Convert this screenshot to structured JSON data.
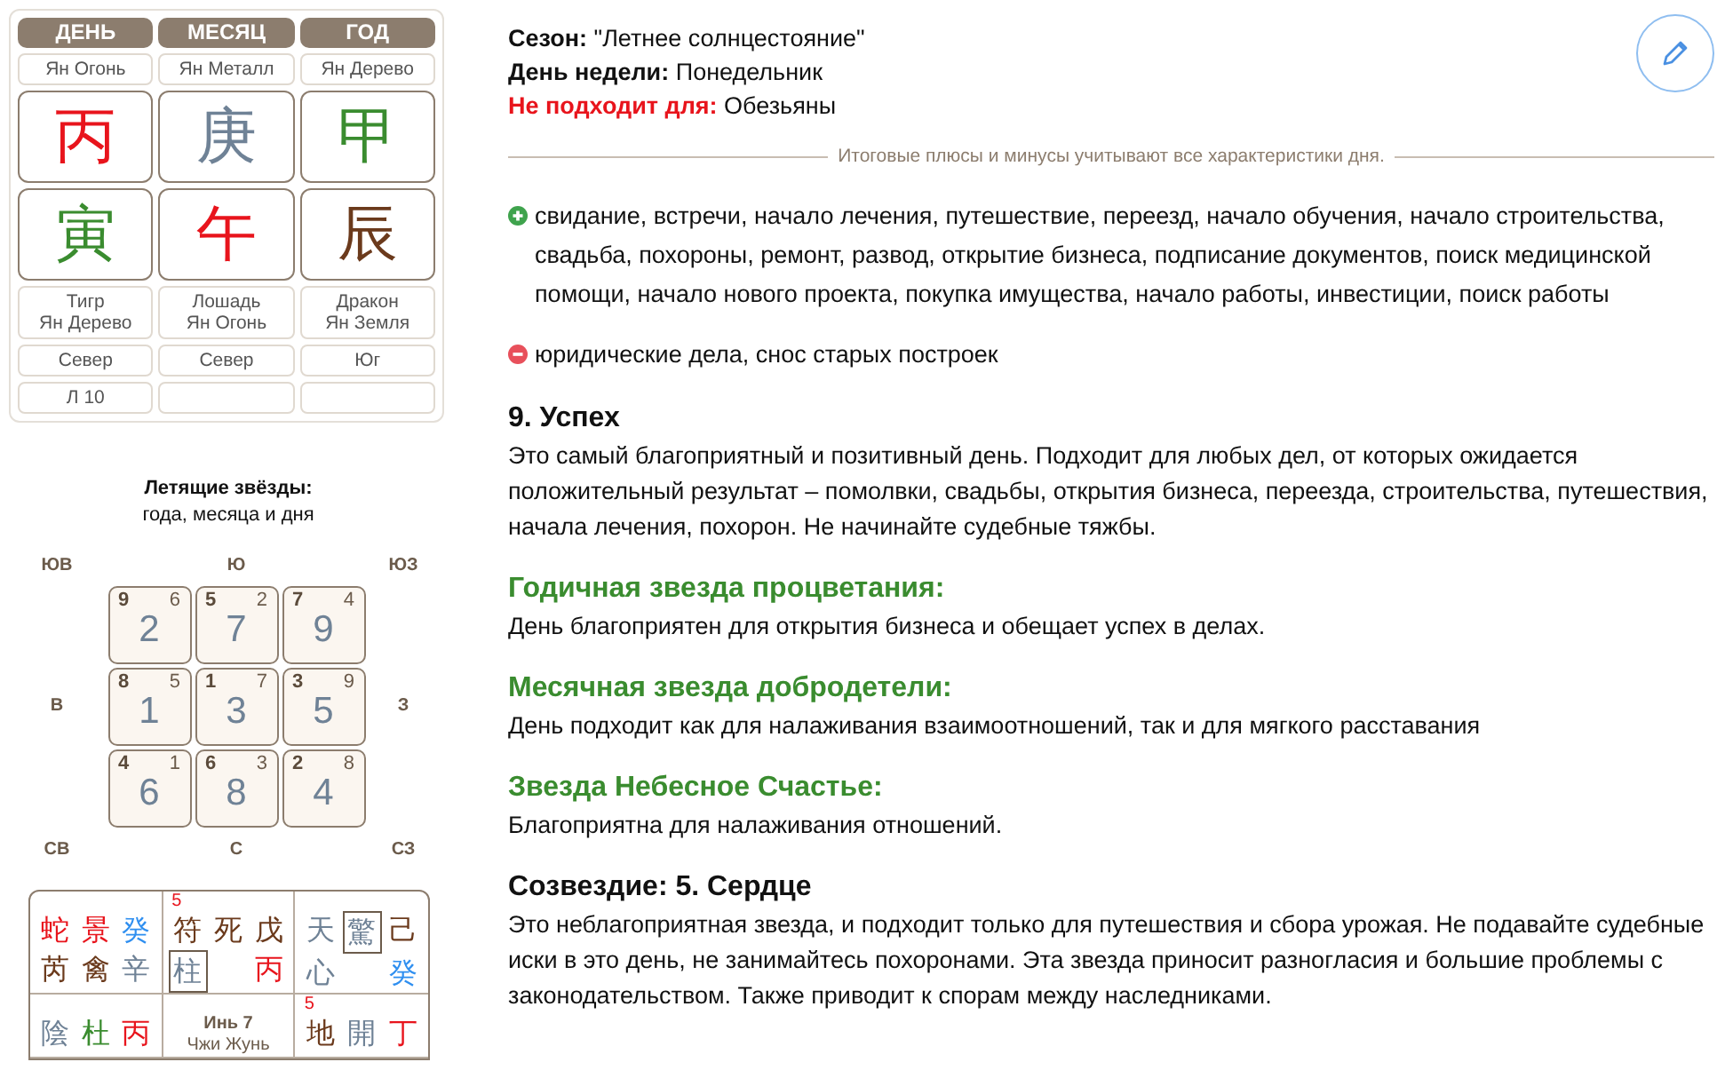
{
  "pillars": [
    {
      "heading": "ДЕНЬ",
      "element": "Ян Огонь",
      "stem": {
        "char": "丙",
        "color": "#e8141c"
      },
      "branch": {
        "char": "寅",
        "color": "#3a8c2f"
      },
      "animal": "Тигр",
      "animal_element": "Ян Дерево",
      "direction": "Север",
      "extra": "Л 10"
    },
    {
      "heading": "МЕСЯЦ",
      "element": "Ян Металл",
      "stem": {
        "char": "庚",
        "color": "#6f8296"
      },
      "branch": {
        "char": "午",
        "color": "#e8141c"
      },
      "animal": "Лошадь",
      "animal_element": "Ян Огонь",
      "direction": "Север"
    },
    {
      "heading": "ГОД",
      "element": "Ян Дерево",
      "stem": {
        "char": "甲",
        "color": "#3a8c2f"
      },
      "branch": {
        "char": "辰",
        "color": "#6b3a1c"
      },
      "animal": "Дракон",
      "animal_element": "Ян Земля",
      "direction": "Юг"
    }
  ],
  "flying_stars": {
    "title": "Летящие звёзды:",
    "subtitle": "года, месяца и дня",
    "directions_top": [
      "ЮВ",
      "Ю",
      "ЮЗ"
    ],
    "directions_middle": [
      "В",
      "З"
    ],
    "directions_bottom": [
      "СВ",
      "С",
      "СЗ"
    ],
    "cells": [
      {
        "year": "9",
        "month": "6",
        "day": "2"
      },
      {
        "year": "5",
        "month": "2",
        "day": "7"
      },
      {
        "year": "7",
        "month": "4",
        "day": "9"
      },
      {
        "year": "8",
        "month": "5",
        "day": "1"
      },
      {
        "year": "1",
        "month": "7",
        "day": "3"
      },
      {
        "year": "3",
        "month": "9",
        "day": "5"
      },
      {
        "year": "4",
        "month": "1",
        "day": "6"
      },
      {
        "year": "6",
        "month": "3",
        "day": "8"
      },
      {
        "year": "2",
        "month": "8",
        "day": "4"
      }
    ]
  },
  "qimen": [
    {
      "rows": [
        [
          {
            "char": "蛇",
            "color": "#e8141c",
            "boxed": false
          },
          {
            "char": "景",
            "color": "#e8141c",
            "boxed": false
          },
          {
            "char": "癸",
            "color": "#2f8ff0",
            "boxed": false
          }
        ],
        [
          {
            "char": "芮",
            "color": "#6b3a1c",
            "boxed": false
          },
          {
            "char": "禽",
            "color": "#6b3a1c",
            "boxed": false
          },
          {
            "char": "辛",
            "color": "#6f8296",
            "boxed": false
          }
        ]
      ]
    },
    {
      "number": "5",
      "rows": [
        [
          {
            "char": "符",
            "color": "#6b3a1c",
            "boxed": false
          },
          {
            "char": "死",
            "color": "#6b3a1c",
            "boxed": false
          },
          {
            "char": "戊",
            "color": "#6b3a1c",
            "boxed": false
          }
        ],
        [
          {
            "char": "柱",
            "color": "#6f8296",
            "boxed": true
          },
          null,
          {
            "char": "丙",
            "color": "#e8141c",
            "boxed": false
          }
        ]
      ]
    },
    {
      "rows": [
        [
          {
            "char": "天",
            "color": "#6f8296",
            "boxed": false
          },
          {
            "char": "驚",
            "color": "#6f8296",
            "boxed": true
          },
          {
            "char": "己",
            "color": "#6b3a1c",
            "boxed": false
          }
        ],
        [
          {
            "char": "心",
            "color": "#6f8296",
            "boxed": false
          },
          null,
          {
            "char": "癸",
            "color": "#2f8ff0",
            "boxed": false
          }
        ]
      ]
    },
    {
      "rows": [
        [
          {
            "char": "陰",
            "color": "#6f8296",
            "boxed": false
          },
          {
            "char": "杜",
            "color": "#3a8c2f",
            "boxed": false
          },
          {
            "char": "丙",
            "color": "#e8141c",
            "boxed": false
          }
        ]
      ]
    },
    {
      "center": [
        "Инь 7",
        "Чжи Жунь"
      ]
    },
    {
      "number": "5",
      "rows": [
        [
          {
            "char": "地",
            "color": "#6b3a1c",
            "boxed": false
          },
          {
            "char": "開",
            "color": "#6f8296",
            "boxed": false
          },
          {
            "char": "丁",
            "color": "#e8141c",
            "boxed": false
          }
        ]
      ]
    }
  ],
  "info": [
    {
      "kind": "normal",
      "label": "Сезон:",
      "value": "\"Летнее солнцестояние\""
    },
    {
      "kind": "normal",
      "label": "День недели:",
      "value": "Понедельник"
    },
    {
      "kind": "warning",
      "label": "Не подходит для:",
      "value": "Обезьяны"
    }
  ],
  "divider_note": "Итоговые плюсы и минусы учитывают все характеристики дня.",
  "pros_cons": [
    {
      "kind": "plus",
      "text": "свидание, встречи, начало лечения, путешествие, переезд, начало обучения, начало строительства, свадьба, похороны, ремонт, развод, открытие бизнеса, подписание документов, поиск медицинской помощи, начало нового проекта, покупка имущества, начало работы, инвестиции, поиск работы"
    },
    {
      "kind": "minus",
      "text": "юридические дела, снос старых построек"
    }
  ],
  "sections": [
    {
      "kind": "main",
      "title": "9. Успех",
      "text": "Это самый благоприятный и позитивный день. Подходит для любых дел, от которых ожидается положительный результат – помолвки, свадьбы, открытия бизнеса, переезда, строительства, путешествия, начала лечения, похорон. Не начинайте судебные тяжбы."
    },
    {
      "kind": "star",
      "title": "Годичная звезда процветания:",
      "text": "День благоприятен для открытия бизнеса и обещает успех в делах."
    },
    {
      "kind": "star",
      "title": "Месячная звезда добродетели:",
      "text": "День подходит как для налаживания взаимоотношений, так и для мягкого расставания"
    },
    {
      "kind": "star",
      "title": "Звезда Небесное Счастье:",
      "text": "Благоприятна для налаживания отношений."
    },
    {
      "kind": "main",
      "title": "Созвездие: 5. Сердце",
      "text": "Это неблагоприятная звезда, и подходит только для путешествия и сбора урожая. Не подавайте судебные иски в это день, не занимайтесь похоронами. Эта звезда приносит разногласия и большие проблемы с законодательством. Также приводит к спорам между наследниками."
    }
  ]
}
